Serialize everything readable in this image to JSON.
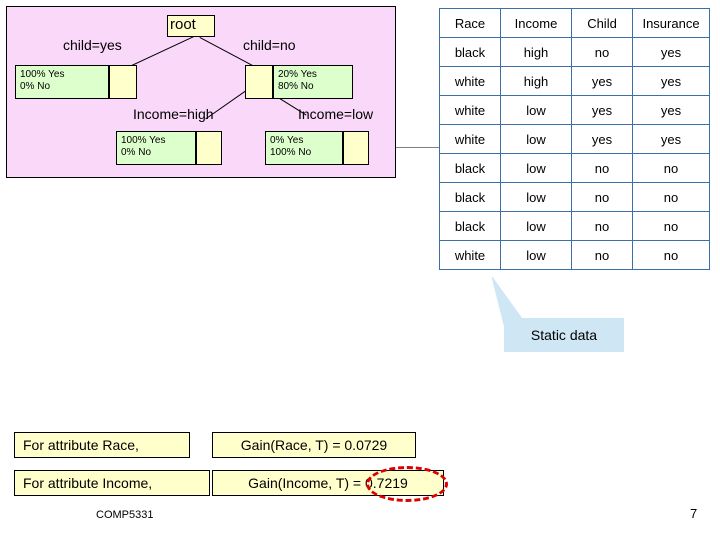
{
  "tree": {
    "root_label": "root",
    "branch_left_label": "child=yes",
    "branch_right_label": "child=no",
    "left_stats": "100% Yes\n0% No",
    "left_stats_line1": "100% Yes",
    "left_stats_line2": "0% No",
    "right_stats_line1": "20% Yes",
    "right_stats_line2": "80% No",
    "income_high_label": "Income=high",
    "income_low_label": "Income=low",
    "income_high_stats_line1": "100% Yes",
    "income_high_stats_line2": "0% No",
    "income_low_stats_line1": "0% Yes",
    "income_low_stats_line2": "100% No"
  },
  "table": {
    "headers": [
      "Race",
      "Income",
      "Child",
      "Insurance"
    ],
    "rows": [
      [
        "black",
        "high",
        "no",
        "yes"
      ],
      [
        "white",
        "high",
        "yes",
        "yes"
      ],
      [
        "white",
        "low",
        "yes",
        "yes"
      ],
      [
        "white",
        "low",
        "yes",
        "yes"
      ],
      [
        "black",
        "low",
        "no",
        "no"
      ],
      [
        "black",
        "low",
        "no",
        "no"
      ],
      [
        "black",
        "low",
        "no",
        "no"
      ],
      [
        "white",
        "low",
        "no",
        "no"
      ]
    ]
  },
  "callout": {
    "text": "Static data"
  },
  "statements": {
    "race_attribute": "For attribute Race,",
    "race_gain": "Gain(Race, T) = 0.0729",
    "income_attribute": "For attribute Income,",
    "income_gain": "Gain(Income, T) = 0.7219"
  },
  "footer": {
    "course": "COMP5331",
    "page": "7"
  }
}
